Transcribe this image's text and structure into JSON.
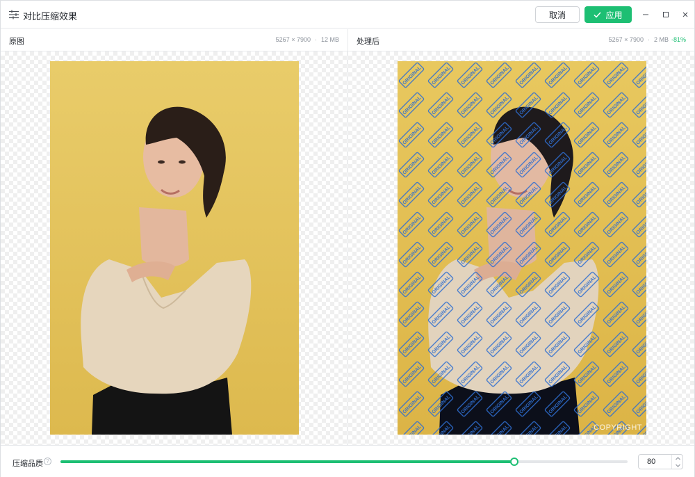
{
  "window": {
    "title": "对比压缩效果",
    "title_icon": "sliders-icon"
  },
  "toolbar": {
    "cancel_label": "取消",
    "apply_label": "应用",
    "apply_icon": "check-icon",
    "accent_color": "#1dbf73"
  },
  "window_controls": [
    "minimize-icon",
    "maximize-icon",
    "close-icon"
  ],
  "original": {
    "label": "原图",
    "dimensions": "5267 × 7900",
    "separator": "·",
    "size": "12 MB"
  },
  "processed": {
    "label": "处理后",
    "dimensions": "5267 × 7900",
    "separator": "·",
    "size": "2 MB",
    "saving": "-81%",
    "watermark_text": "ORIGINAL",
    "copyright_text": "COPYRIGHT"
  },
  "quality": {
    "label": "压缩品质",
    "help_icon": "help-icon",
    "value": "80",
    "slider_fraction": 0.8
  }
}
